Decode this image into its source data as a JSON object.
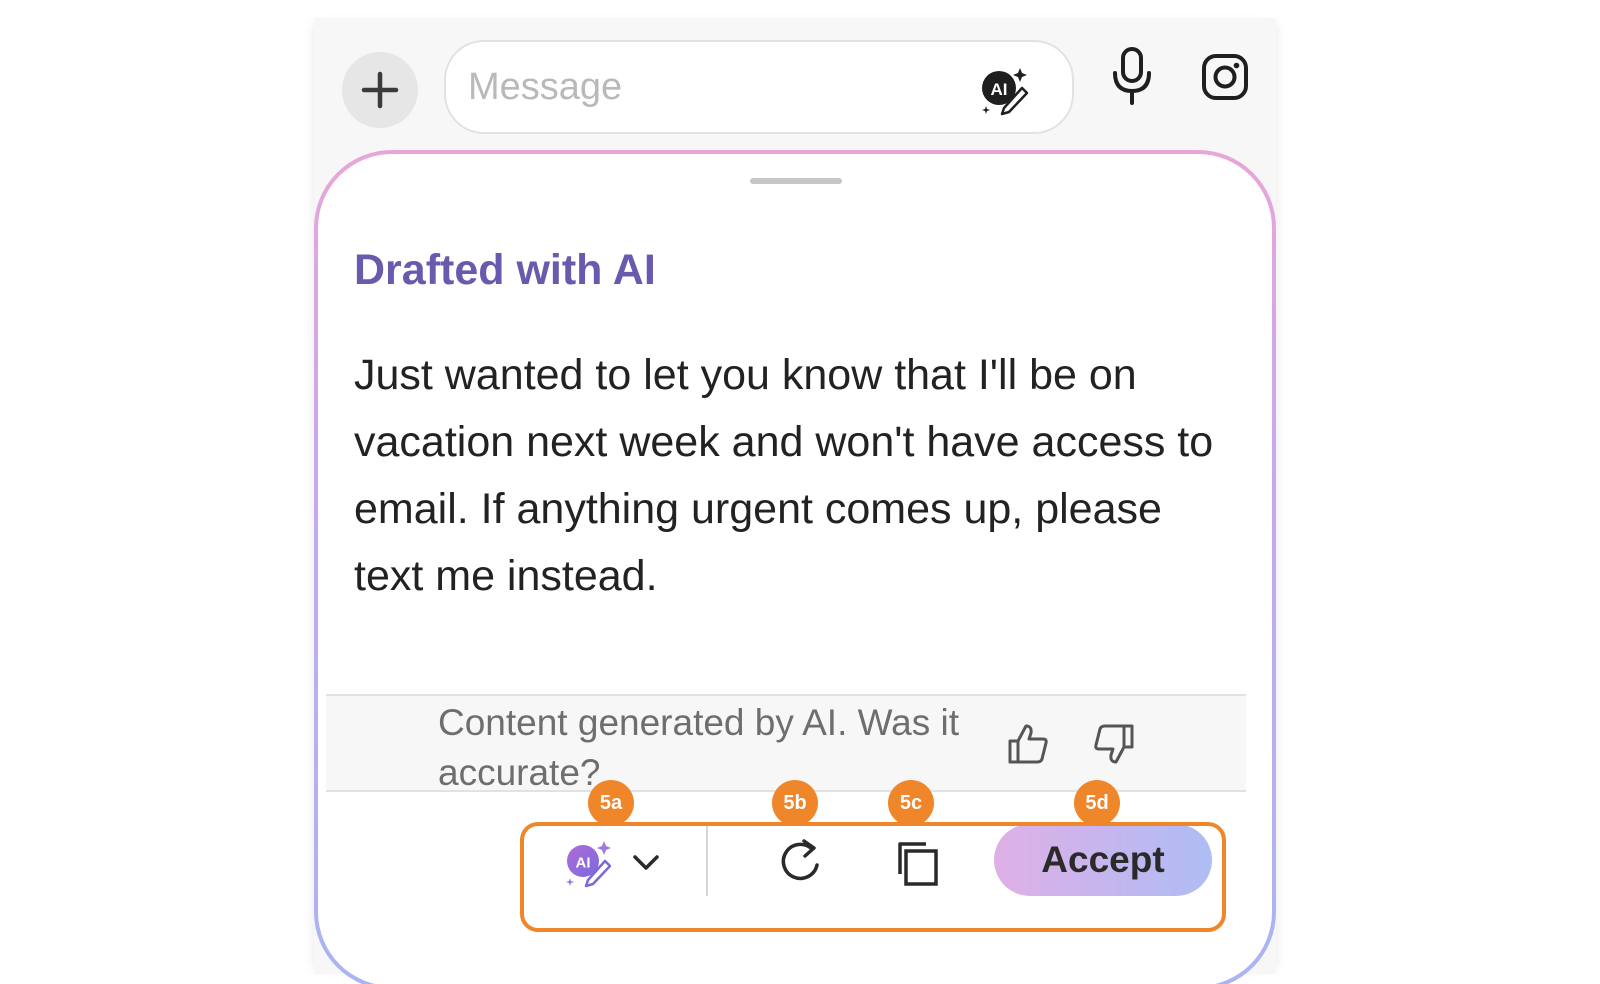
{
  "composer": {
    "placeholder": "Message",
    "ai_badge": "AI",
    "icons": [
      "plus-icon",
      "ai-writer-icon",
      "microphone-icon",
      "instagram-icon"
    ]
  },
  "sheet": {
    "title": "Drafted with AI",
    "draft_text": "Just wanted to let you know that I'll be on vacation next week and won't have access to email. If anything urgent comes up, please text me instead.",
    "feedback_text": "Content generated by AI. Was it accurate?",
    "feedback_icons": [
      "thumbs-up-icon",
      "thumbs-down-icon"
    ]
  },
  "toolbar": {
    "ai_menu_badge": "AI",
    "accept_label": "Accept",
    "icons": [
      "ai-writer-icon",
      "chevron-down-icon",
      "refresh-icon",
      "copy-icon"
    ]
  },
  "annotations": {
    "labels": [
      "5a",
      "5b",
      "5c",
      "5d"
    ],
    "color": "#f0862a"
  },
  "colors": {
    "title": "#6a5aae",
    "accept_gradient": [
      "#dfb0e6",
      "#aebdf4"
    ],
    "sheet_border": [
      "#e8a6d8",
      "#aab4f2"
    ]
  }
}
